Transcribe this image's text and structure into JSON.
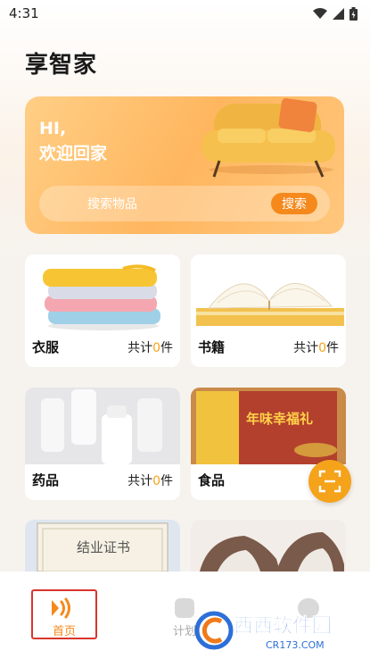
{
  "status": {
    "time": "4:31"
  },
  "app": {
    "title": "享智家"
  },
  "banner": {
    "greeting_line1": "HI,",
    "greeting_line2": "欢迎回家",
    "search_placeholder": "搜索物品",
    "search_button": "搜索"
  },
  "categories": [
    {
      "name": "衣服",
      "count_prefix": "共计",
      "count": "0",
      "count_suffix": "件"
    },
    {
      "name": "书籍",
      "count_prefix": "共计",
      "count": "0",
      "count_suffix": "件"
    },
    {
      "name": "药品",
      "count_prefix": "共计",
      "count": "0",
      "count_suffix": "件"
    },
    {
      "name": "食品",
      "count_prefix": "共",
      "count": "",
      "count_suffix": ""
    }
  ],
  "images": {
    "certificate_text": "结业证书",
    "food_box_text": "年味幸福礼"
  },
  "nav": {
    "home_label": "首页",
    "plan_label": "计划"
  },
  "watermark": {
    "text": "西西软件园",
    "url": "CR173.COM"
  },
  "colors": {
    "accent": "#f5a31a",
    "banner": "#ffb65f",
    "highlight_border": "#d9352b"
  }
}
